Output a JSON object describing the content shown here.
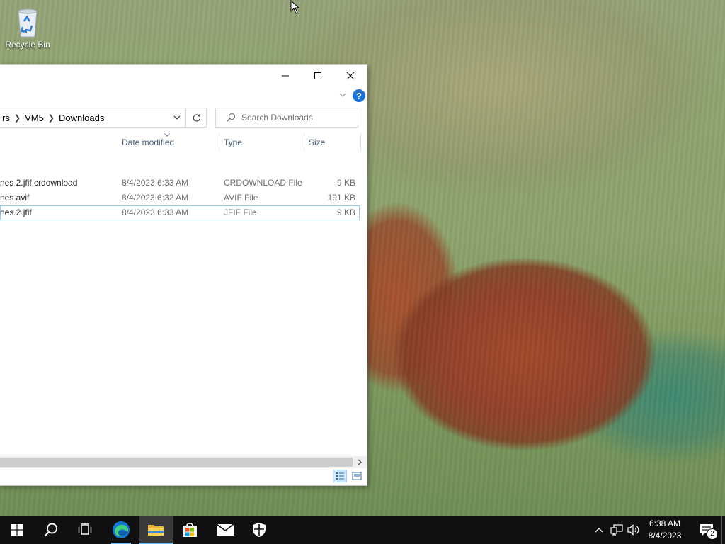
{
  "desktop": {
    "recycle_bin_label": "Recycle Bin"
  },
  "window": {
    "breadcrumb": [
      "rs",
      "VM5",
      "Downloads"
    ],
    "search_placeholder": "Search Downloads",
    "columns": {
      "date": "Date modified",
      "type": "Type",
      "size": "Size"
    },
    "files": [
      {
        "name": "nes 2.jfif.crdownload",
        "date": "8/4/2023 6:33 AM",
        "type": "CRDOWNLOAD File",
        "size": "9 KB"
      },
      {
        "name": "nes.avif",
        "date": "8/4/2023 6:32 AM",
        "type": "AVIF File",
        "size": "191 KB"
      },
      {
        "name": "nes 2.jfif",
        "date": "8/4/2023 6:33 AM",
        "type": "JFIF File",
        "size": "9 KB"
      }
    ],
    "help_glyph": "?"
  },
  "taskbar": {
    "time": "6:38 AM",
    "date": "8/4/2023",
    "notification_count": "2"
  },
  "colors": {
    "accent": "#76b9ed",
    "taskbar_bg": "#101010",
    "selection_border": "#99c9f0"
  }
}
